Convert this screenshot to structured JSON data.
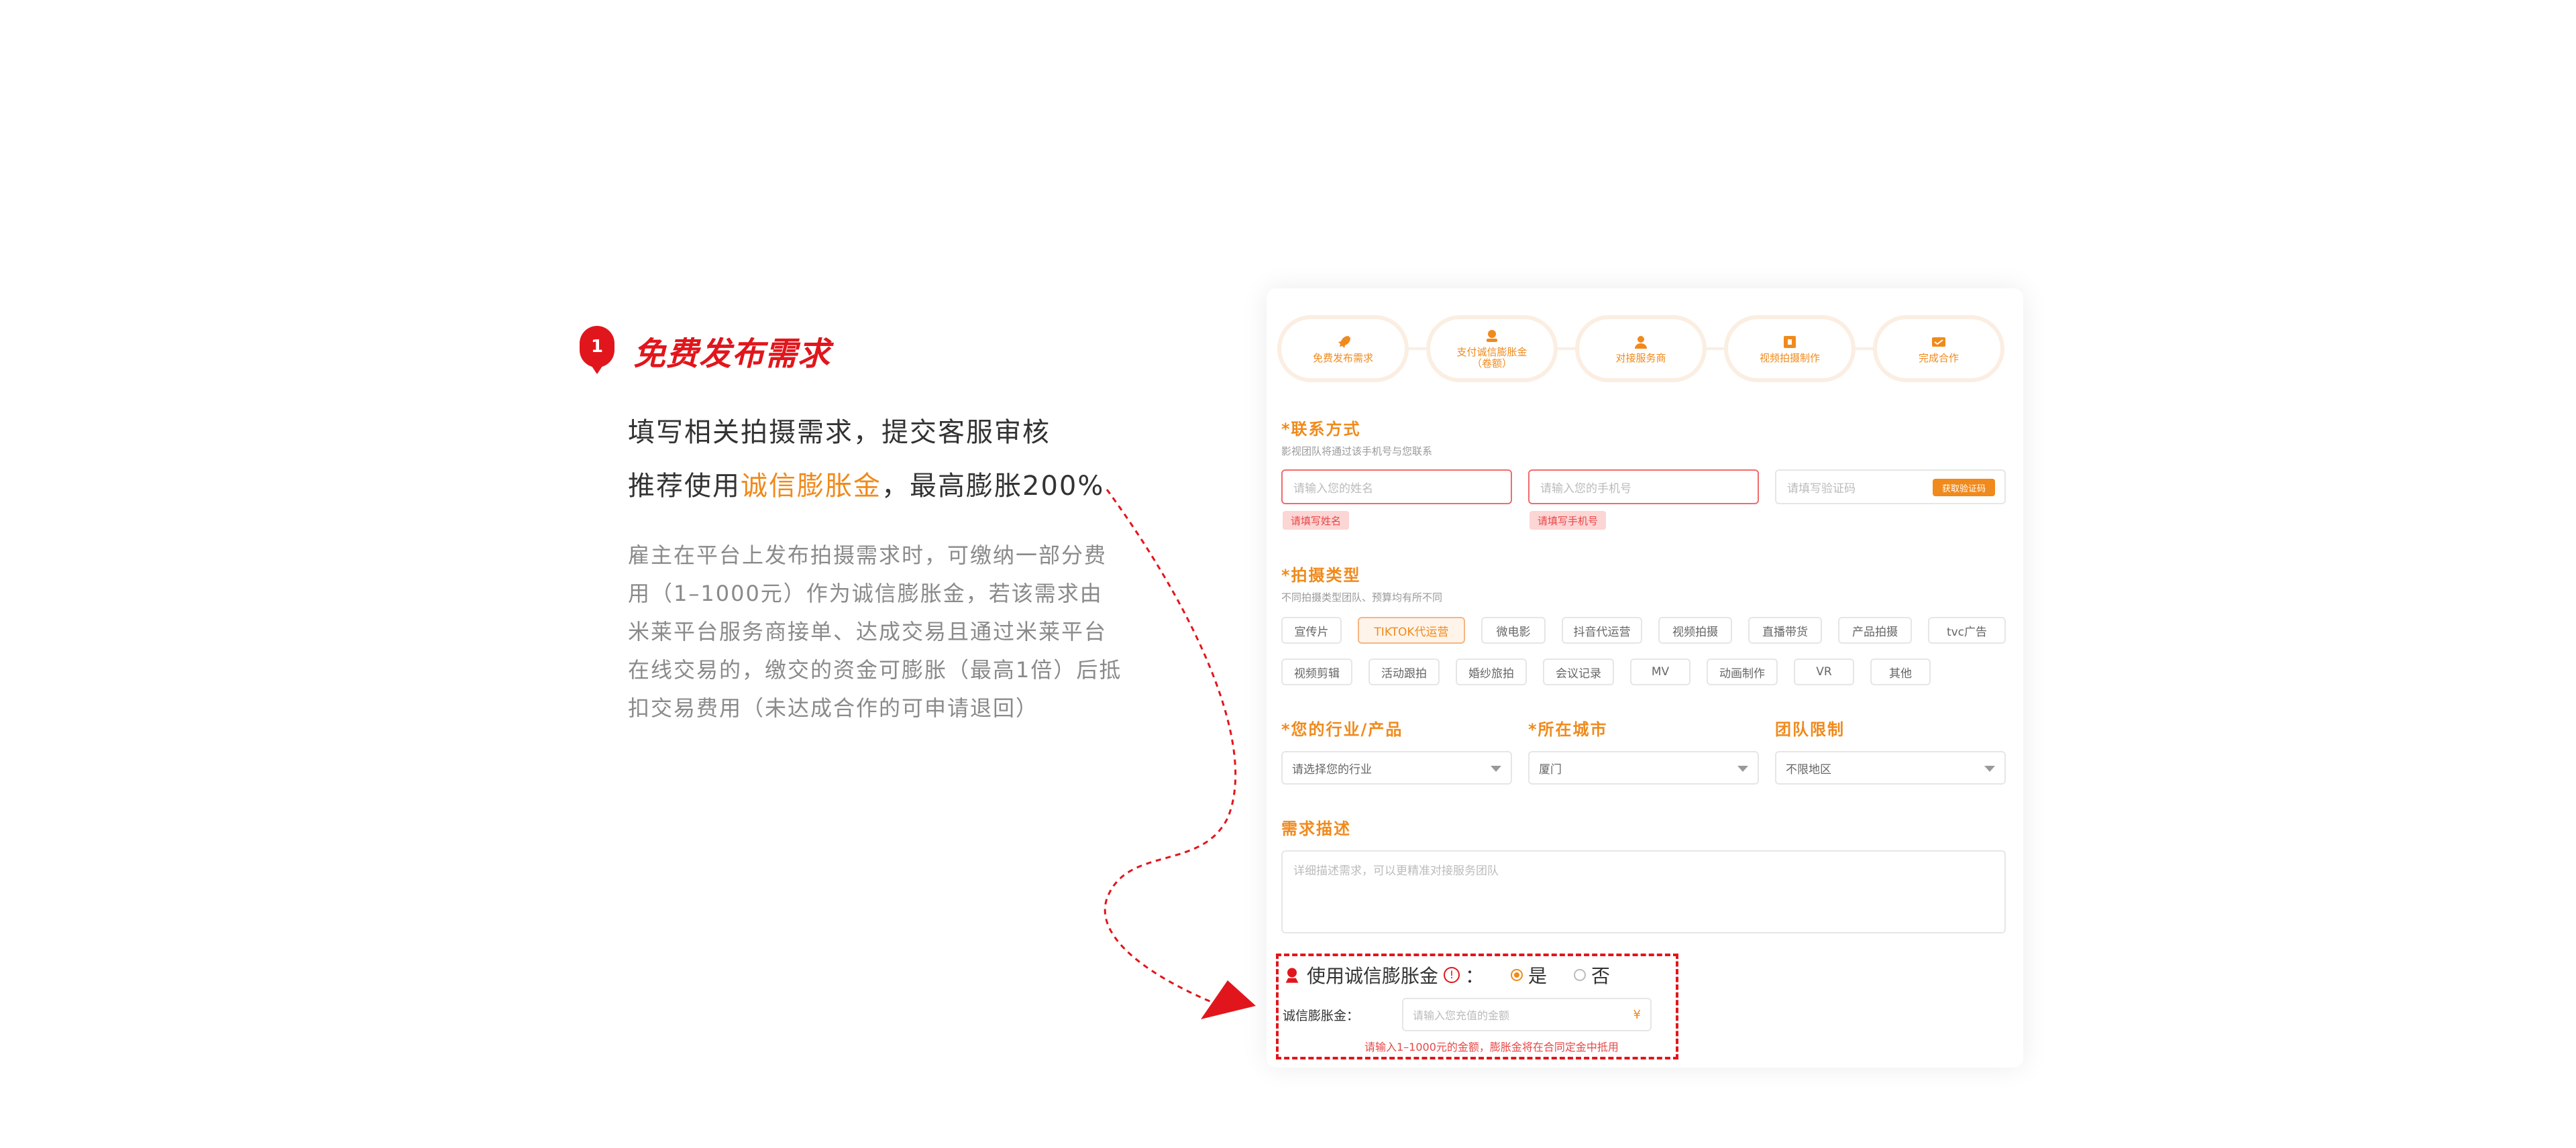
{
  "intro": {
    "step_number": "1",
    "title": "免费发布需求",
    "line1": "填写相关拍摄需求，提交客服审核",
    "line2_prefix": "推荐使用",
    "line2_highlight": "诚信膨胀金",
    "line2_suffix": "，最高膨胀200%",
    "description": [
      "雇主在平台上发布拍摄需求时，可缴纳一部分费",
      "用（1–1000元）作为诚信膨胀金，若该需求由",
      "米莱平台服务商接单、达成交易且通过米莱平台",
      "在线交易的，缴交的资金可膨胀（最高1倍）后抵",
      "扣交易费用（未达成合作的可申请退回）"
    ]
  },
  "colors": {
    "brand_red": "#e1161c",
    "accent_orange": "#f08a1c"
  },
  "steps": [
    {
      "label": "免费发布需求",
      "icon": "rocket-icon"
    },
    {
      "label": "支付诚信膨胀金（卷额）",
      "icon": "deposit-icon"
    },
    {
      "label": "对接服务商",
      "icon": "person-icon"
    },
    {
      "label": "视频拍摄制作",
      "icon": "film-icon"
    },
    {
      "label": "完成合作",
      "icon": "handshake-icon"
    }
  ],
  "contact": {
    "title": "*联系方式",
    "hint": "影视团队将通过该手机号与您联系",
    "name_placeholder": "请输入您的姓名",
    "phone_placeholder": "请输入您的手机号",
    "code_placeholder": "请填写验证码",
    "code_button": "获取验证码",
    "name_error": "请填写姓名",
    "phone_error": "请填写手机号"
  },
  "shoot_type": {
    "title": "*拍摄类型",
    "hint": "不同拍摄类型团队、预算均有所不同",
    "options": [
      "宣传片",
      "TIKTOK代运营",
      "微电影",
      "抖音代运营",
      "视频拍摄",
      "直播带货",
      "产品拍摄",
      "tvc广告",
      "视频剪辑",
      "活动跟拍",
      "婚纱旅拍",
      "会议记录",
      "MV",
      "动画制作",
      "VR",
      "其他"
    ],
    "selected": "TIKTOK代运营"
  },
  "industry": {
    "title": "*您的行业/产品",
    "value": "请选择您的行业"
  },
  "city": {
    "title": "*所在城市",
    "value": "厦门"
  },
  "team": {
    "title": "团队限制",
    "value": "不限地区"
  },
  "requirement": {
    "title": "需求描述",
    "placeholder": "详细描述需求，可以更精准对接服务团队"
  },
  "deposit": {
    "question": "使用诚信膨胀金",
    "colon": "：",
    "yes": "是",
    "no": "否",
    "selected": "是",
    "amount_label": "诚信膨胀金：",
    "amount_placeholder": "请输入您充值的金额",
    "currency": "¥",
    "hint": "请输入1–1000元的金额，膨胀金将在合同定金中抵用"
  }
}
